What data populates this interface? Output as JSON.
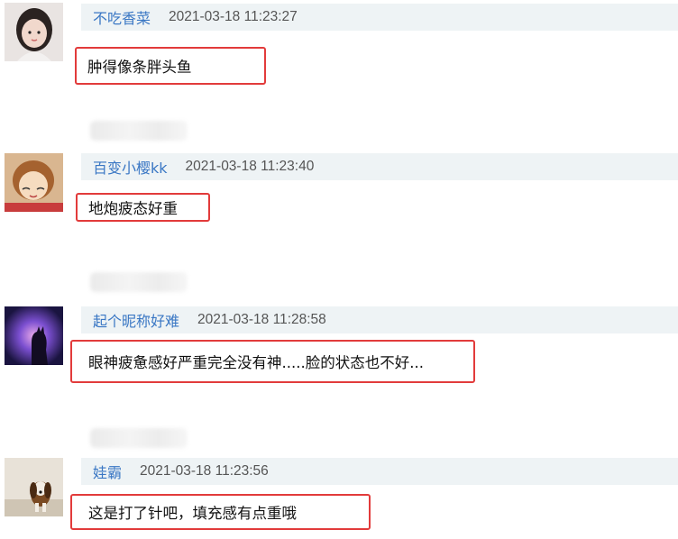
{
  "comments": [
    {
      "username": "不吃香菜",
      "time": "2021-03-18 11:23:27",
      "content": "肿得像条胖头鱼",
      "avatar_icon": "girl-photo-avatar"
    },
    {
      "username": "百变小樱kk",
      "time": "2021-03-18 11:23:40",
      "content": "地炮疲态好重",
      "avatar_icon": "anime-girl-avatar"
    },
    {
      "username": "起个昵称好难",
      "time": "2021-03-18 11:28:58",
      "content": "眼神疲惫感好严重完全没有神.....脸的状态也不好...",
      "avatar_icon": "cat-silhouette-avatar"
    },
    {
      "username": "娃霸",
      "time": "2021-03-18 11:23:56",
      "content": "这是打了针吧，填充感有点重哦",
      "avatar_icon": "puppy-photo-avatar"
    }
  ],
  "colors": {
    "username": "#3a77c4",
    "highlight_border": "#e23b3b",
    "header_bg": "#eef3f5"
  }
}
